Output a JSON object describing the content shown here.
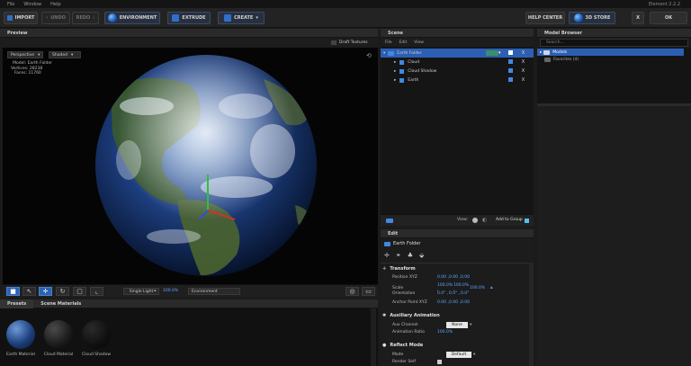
{
  "menu": {
    "items": [
      "File",
      "Window",
      "Help"
    ],
    "version": "Element 2.2.2"
  },
  "toolbar": {
    "import": "IMPORT",
    "undo": "UNDO",
    "redo": "REDO",
    "environment": "ENVIRONMENT",
    "extrude": "EXTRUDE",
    "create": "CREATE",
    "help_center": "HELP CENTER",
    "store": "3D STORE",
    "close": "X",
    "ok": "OK"
  },
  "preview": {
    "title": "Preview",
    "draft_textures": "Draft Textures",
    "camera": "Perspective",
    "shading": "Shaded",
    "model_label": "Model:",
    "model_value": "Earth Folder",
    "vertices_label": "Vertices:",
    "vertices_value": "28238",
    "faces_label": "Faces:",
    "faces_value": "11760",
    "light": "Single Light",
    "light_pct": "100.0%",
    "environment": "Environment"
  },
  "scene": {
    "title": "Scene",
    "menu": [
      "File",
      "Edit",
      "View"
    ],
    "items": [
      {
        "name": "Earth Folder",
        "x": "X"
      },
      {
        "name": "Cloud",
        "x": "X"
      },
      {
        "name": "Cloud Shadow",
        "x": "X"
      },
      {
        "name": "Earth",
        "x": "X"
      }
    ],
    "view_label": "View:",
    "add_to_group": "Add to Group"
  },
  "model_browser": {
    "title": "Model Browser",
    "search_placeholder": "Search...",
    "items": [
      "Models",
      "Favorites (4)"
    ]
  },
  "edit": {
    "title": "Edit",
    "object": "Earth Folder",
    "transform": "Transform",
    "position_label": "Position XYZ",
    "position": [
      "0.00 ,",
      "0.00 ,",
      "0.00"
    ],
    "scale_label": "Scale",
    "scale": [
      "100.0% ,",
      "100.0% ,",
      "100.0%"
    ],
    "orientation_label": "Orientation",
    "orientation": [
      "0.0° ,",
      "0.0° ,",
      "0.0°"
    ],
    "anchor_label": "Anchor Point XYZ",
    "anchor": [
      "0.00 ,",
      "0.00 ,",
      "0.00"
    ],
    "aux": "Auxiliary Animation",
    "aux_channel_label": "Aux Channel",
    "aux_channel": "None",
    "anim_ratio_label": "Animation Ratio",
    "anim_ratio": "100.0%",
    "reflect": "Reflect Mode",
    "mode_label": "Mode",
    "mode": "Default",
    "render_self_label": "Render Self"
  },
  "presets": {
    "tabs": [
      "Presets",
      "Scene Materials"
    ],
    "materials": [
      "Earth Material",
      "Cloud Material",
      "Cloud Shadow"
    ]
  }
}
